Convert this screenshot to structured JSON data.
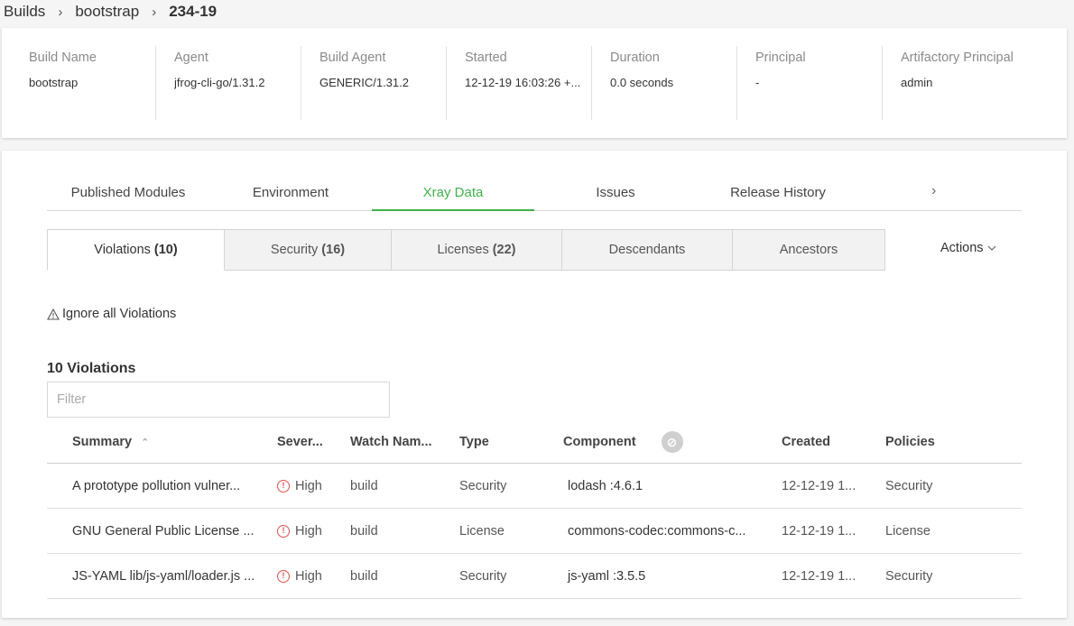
{
  "breadcrumb": {
    "items": [
      "Builds",
      "bootstrap"
    ],
    "current": "234-19"
  },
  "summary": {
    "columns": [
      {
        "label": "Build Name",
        "value": "bootstrap"
      },
      {
        "label": "Agent",
        "value": "jfrog-cli-go/1.31.2"
      },
      {
        "label": "Build Agent",
        "value": "GENERIC/1.31.2"
      },
      {
        "label": "Started",
        "value": "12-12-19 16:03:26 +..."
      },
      {
        "label": "Duration",
        "value": "0.0 seconds"
      },
      {
        "label": "Principal",
        "value": "-"
      },
      {
        "label": "Artifactory Principal",
        "value": "admin"
      }
    ]
  },
  "tabs": [
    {
      "label": "Published Modules"
    },
    {
      "label": "Environment"
    },
    {
      "label": "Xray Data",
      "active": true
    },
    {
      "label": "Issues"
    },
    {
      "label": "Release History"
    }
  ],
  "subtabs": [
    {
      "label": "Violations",
      "count": "(10)",
      "active": true
    },
    {
      "label": "Security",
      "count": "(16)"
    },
    {
      "label": "Licenses",
      "count": "(22)"
    },
    {
      "label": "Descendants",
      "count": ""
    },
    {
      "label": "Ancestors",
      "count": ""
    }
  ],
  "actions_label": "Actions",
  "ignore_label": "Ignore all Violations",
  "section_title": "10 Violations",
  "filter_placeholder": "Filter",
  "table": {
    "headers": {
      "summary": "Summary",
      "severity": "Sever...",
      "watch": "Watch Nam...",
      "type": "Type",
      "component": "Component",
      "created": "Created",
      "policies": "Policies"
    },
    "rows": [
      {
        "summary": "A prototype pollution vulner...",
        "severity": "High",
        "watch": "build",
        "type": "Security",
        "component": "lodash :4.6.1",
        "created": "12-12-19 1...",
        "policies": "Security"
      },
      {
        "summary": "GNU General Public License ...",
        "severity": "High",
        "watch": "build",
        "type": "License",
        "component": "commons-codec:commons-c...",
        "created": "12-12-19 1...",
        "policies": "License"
      },
      {
        "summary": "JS-YAML lib/js-yaml/loader.js ...",
        "severity": "High",
        "watch": "build",
        "type": "Security",
        "component": "js-yaml :3.5.5",
        "created": "12-12-19 1...",
        "policies": "Security"
      }
    ]
  },
  "colors": {
    "accent": "#41b14a",
    "severity_high": "#d9534f"
  },
  "icons": {
    "breadcrumb_sep": "chevron-right-icon",
    "tab_arrow": "chevron-right-icon",
    "actions": "chevron-down-icon",
    "ignore": "warning-icon",
    "sort": "sort-asc-icon",
    "severity": "alert-circle-icon",
    "component": "link-icon"
  }
}
